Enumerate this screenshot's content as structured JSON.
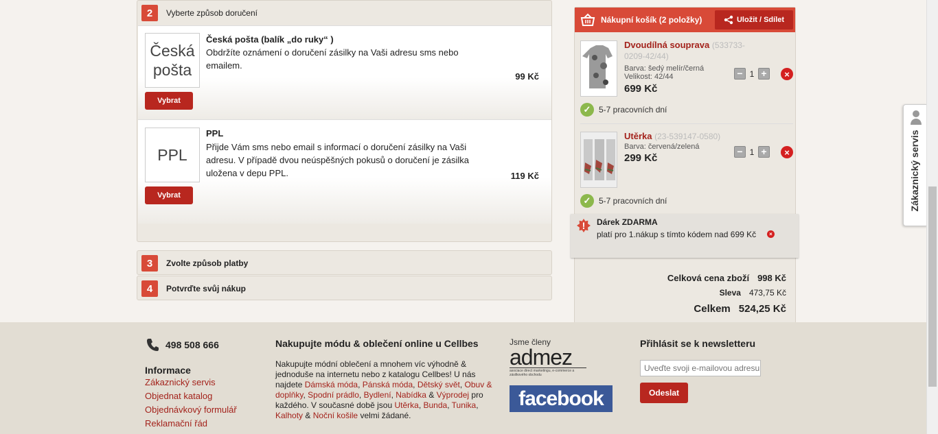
{
  "steps": {
    "step2": {
      "num": "2",
      "title": "Vyberte způsob doručení"
    },
    "step3": {
      "num": "3",
      "title": "Zvolte způsob platby"
    },
    "step4": {
      "num": "4",
      "title": "Potvrďte svůj nákup"
    }
  },
  "shipping": [
    {
      "logo_line1": "Česká",
      "logo_line2": "pošta",
      "name": "Česká pošta (balík „do ruky“ )",
      "desc": "Obdržíte oznámení o doručení zásilky na Vaši adresu sms nebo emailem.",
      "price": "99 Kč",
      "button": "Vybrat"
    },
    {
      "logo_line1": "PPL",
      "name": "PPL",
      "desc": "Přijde Vám sms nebo email s informací o doručení zásilky na Vaši adresu. V případě dvou neúspěšných pokusů o doručení je zásilka uložena v depu PPL.",
      "price": "119 Kč",
      "button": "Vybrat"
    }
  ],
  "cart": {
    "title": "Nákupní košík (2 položky)",
    "save_label": "Uložit / Sdílet",
    "items": [
      {
        "name": "Dvoudílná souprava",
        "code": "(533733-0209-42/44)",
        "color": "Barva: šedý melír/černá",
        "size": "Velikost: 42/44",
        "price": "699 Kč",
        "qty": "1",
        "delivery": "5-7 pracovních dní"
      },
      {
        "name": "Utěrka",
        "code": "(23-539147-0580)",
        "color": "Barva: červená/zelená",
        "price": "299 Kč",
        "qty": "1",
        "delivery": "5-7 pracovních dní"
      }
    ],
    "gift": {
      "title": "Dárek ZDARMA",
      "text": "platí pro 1.nákup s tímto kódem nad 699 Kč"
    },
    "totals": [
      {
        "label": "Celková cena zboží",
        "value": "998 Kč"
      },
      {
        "label": "Sleva",
        "value": "473,75 Kč"
      },
      {
        "label": "Celkem",
        "value": "524,25 Kč"
      }
    ]
  },
  "side_tab": "Zákaznický servis",
  "footer": {
    "phone": "498 508 666",
    "info_title": "Informace",
    "links": [
      "Zákaznický servis",
      "Objednat katalog",
      "Objednávkový formulář",
      "Reklamační řád"
    ],
    "promo_title": "Nakupujte módu & oblečení online u Cellbes",
    "promo_text_1": "Nakupujte módní oblečení a mnohem víc výhodně & jednoduše na internetu nebo z katalogu Cellbes! U nás najdete",
    "promo_links_1": [
      "Dámská móda",
      "Pánská móda",
      "Dětský svět",
      "Obuv & doplňky",
      "Spodní prádlo",
      "Bydlení",
      "Nabídka"
    ],
    "promo_and": "&",
    "promo_link_vyprodej": "Výprodej",
    "promo_text_2": "pro každého. V současné době jsou",
    "promo_links_2": [
      "Utěrka",
      "Bunda",
      "Tunika",
      "Kalhoty"
    ],
    "promo_link_last": "Noční košile",
    "promo_text_3": "velmi žádané.",
    "members_label": "Jsme členy",
    "admez_logo": "admez",
    "admez_sub": "asociace direct marketingu, e-commerce a zásilkového obchodu",
    "facebook_logo": "facebook",
    "newsletter_title": "Přihlásit se k newsletteru",
    "newsletter_placeholder": "Uveďte svoji e-mailovou adresu",
    "newsletter_button": "Odeslat"
  },
  "colors": {
    "accent": "#d84a38",
    "button": "#b8271f",
    "link": "#a3221b",
    "ok": "#8cb84c"
  }
}
